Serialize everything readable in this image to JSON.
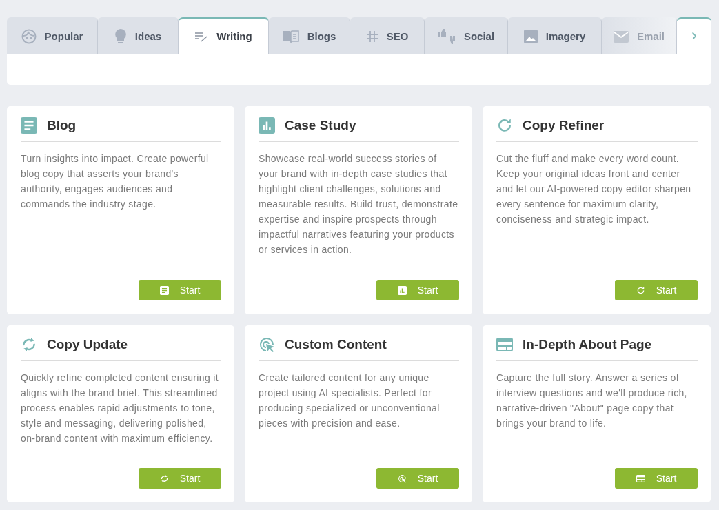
{
  "tabs": [
    {
      "label": "Popular",
      "selected": false,
      "faded": false
    },
    {
      "label": "Ideas",
      "selected": false,
      "faded": false
    },
    {
      "label": "Writing",
      "selected": true,
      "faded": false
    },
    {
      "label": "Blogs",
      "selected": false,
      "faded": false
    },
    {
      "label": "SEO",
      "selected": false,
      "faded": false
    },
    {
      "label": "Social",
      "selected": false,
      "faded": false
    },
    {
      "label": "Imagery",
      "selected": false,
      "faded": false
    },
    {
      "label": "Email",
      "selected": false,
      "faded": true
    }
  ],
  "next_button": {
    "label": "›"
  },
  "cards": [
    {
      "title": "Blog",
      "description": "Turn insights into impact. Create powerful blog copy that asserts your brand's authority, engages audiences and commands the industry stage.",
      "button": "Start"
    },
    {
      "title": "Case Study",
      "description": "Showcase real-world success stories of your brand with in-depth case studies that highlight client challenges, solutions and measurable results. Build trust, demonstrate expertise and inspire prospects through impactful narratives featuring your products or services in action.",
      "button": "Start"
    },
    {
      "title": "Copy Refiner",
      "description": "Cut the fluff and make every word count. Keep your original ideas front and center and let our AI-powered copy editor sharpen every sentence for maximum clarity, conciseness and strategic impact.",
      "button": "Start"
    },
    {
      "title": "Copy Update",
      "description": "Quickly refine completed content ensuring it aligns with the brand brief. This streamlined process enables rapid adjustments to tone, style and messaging, delivering polished, on-brand content with maximum efficiency.",
      "button": "Start"
    },
    {
      "title": "Custom Content",
      "description": "Create tailored content for any unique project using AI specialists. Perfect for producing specialized or unconventional pieces with precision and ease.",
      "button": "Start"
    },
    {
      "title": "In-Depth About Page",
      "description": "Capture the full story. Answer a series of interview questions and we'll produce rich, narrative-driven \"About\" page copy that brings your brand to life.",
      "button": "Start"
    }
  ]
}
